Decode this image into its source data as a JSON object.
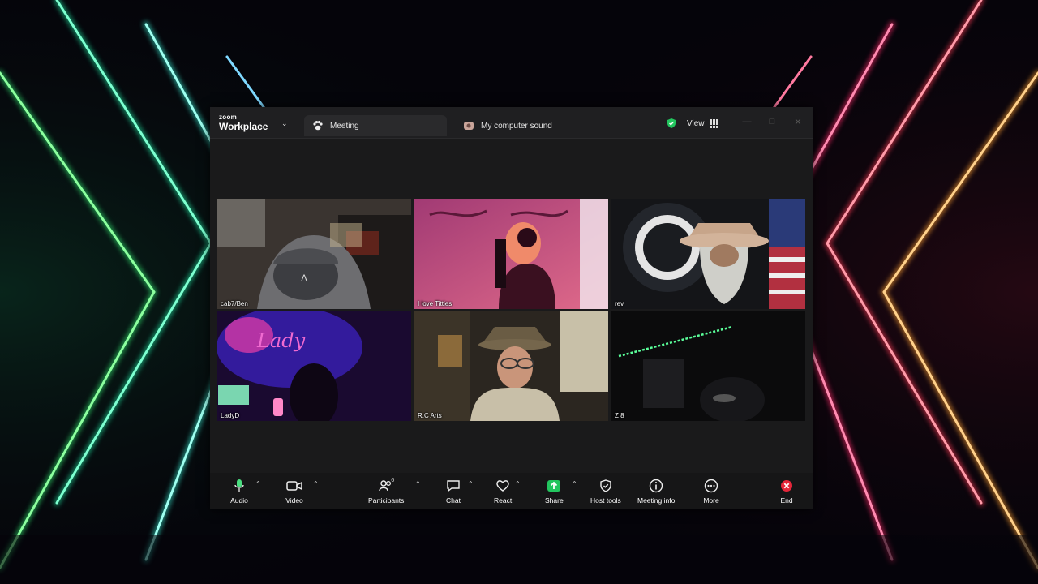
{
  "app": {
    "brand_small": "zoom",
    "brand_name": "Workplace"
  },
  "tabs": [
    {
      "label": "Meeting",
      "icon": "paw-icon"
    },
    {
      "label": "My computer sound",
      "icon": "sound-icon"
    }
  ],
  "header": {
    "view_label": "View",
    "security_icon": "shield-check-icon"
  },
  "participants": [
    {
      "name": "cab7/Ben"
    },
    {
      "name": "I love Titties"
    },
    {
      "name": "rev"
    },
    {
      "name": "LadyD",
      "active_speaker": true
    },
    {
      "name": "R.C Arts"
    },
    {
      "name": "Z 8"
    }
  ],
  "toolbar": {
    "audio": "Audio",
    "video": "Video",
    "participants": "Participants",
    "participant_count": "6",
    "chat": "Chat",
    "react": "React",
    "share": "Share",
    "host_tools": "Host tools",
    "meeting_info": "Meeting info",
    "more": "More",
    "end": "End"
  },
  "colors": {
    "active_speaker_border": "#3fd38a",
    "share_green": "#22c55e",
    "end_red": "#e5263a",
    "mic_green": "#4ade80"
  }
}
